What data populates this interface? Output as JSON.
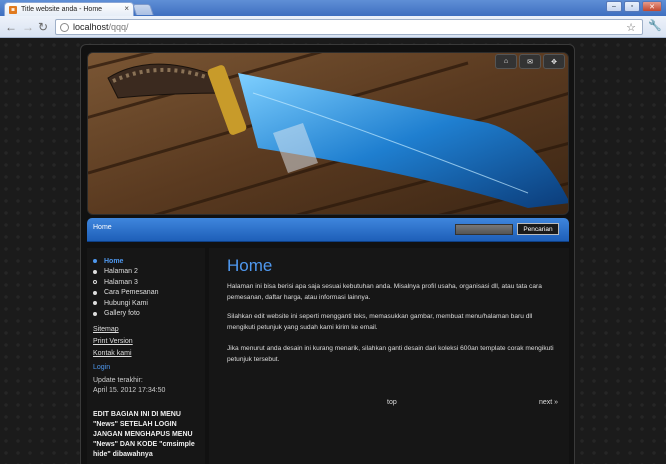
{
  "browser": {
    "tab_title": "Title website anda - Home",
    "url_host": "localhost",
    "url_path": "/qqq/"
  },
  "header": {
    "icons": [
      "home-icon",
      "mail-icon",
      "sitemap-icon"
    ]
  },
  "navbar": {
    "home_label": "Home",
    "search_button": "Pencarian"
  },
  "sidebar": {
    "menu": [
      {
        "label": "Home"
      },
      {
        "label": "Halaman 2"
      },
      {
        "label": "Halaman 3"
      },
      {
        "label": "Cara Pemesanan"
      },
      {
        "label": "Hubungi Kami"
      },
      {
        "label": "Gallery foto"
      }
    ],
    "links": [
      "Sitemap",
      "Print Version",
      "Kontak kami"
    ],
    "login": "Login",
    "updated_label": "Update terakhir:",
    "updated_value": "April 15. 2012 17:34:50",
    "note": "EDIT BAGIAN INI DI MENU \"News\" SETELAH LOGIN JANGAN MENGHAPUS MENU \"News\" DAN KODE \"cmsimple hide\" dibawahnya"
  },
  "main": {
    "title": "Home",
    "p1": "Halaman ini bisa berisi apa saja sesuai kebutuhan anda. Misalnya profil usaha, organisasi dll, atau tata cara pemesanan, daftar harga, atau informasi lainnya.",
    "p2": "Silahkan edit website ini seperti mengganti teks, memasukkan gambar, membuat menu/halaman baru dll mengikuti petunjuk yang sudah kami kirim ke email.",
    "p3": "Jika menurut anda desain ini kurang menarik, silahkan ganti desain dari koleksi 600an template corak mengikuti petunjuk tersebut.",
    "top_link": "top",
    "next_link": "next »"
  }
}
